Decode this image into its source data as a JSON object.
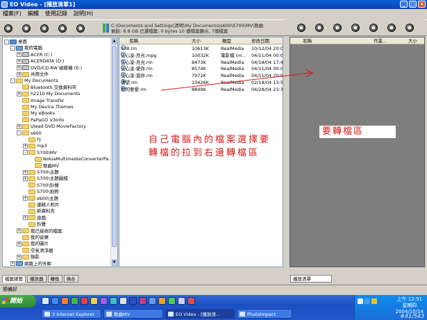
{
  "window": {
    "title": "EO Video - [播放清單1]"
  },
  "menu": [
    "檔案(F)",
    "編輯",
    "使用記錄",
    "說明(H)"
  ],
  "status_info": {
    "line1": "C:\\Documents and Settings\\清明\\My Documents\\s600\\S700\\MV\\歌曲",
    "line2": "剩餘: 8.8 GB    已選檔案: 0 bytes    10 個檔案顯示, 7個檔案"
  },
  "tree": [
    {
      "label": "桌面",
      "level": 0,
      "icon": "desk",
      "exp": "-"
    },
    {
      "label": "我的電腦",
      "level": 1,
      "icon": "pc",
      "exp": "-"
    },
    {
      "label": "ACER (C:)",
      "level": 2,
      "icon": "drive",
      "exp": "+"
    },
    {
      "label": "ACERDATA (D:)",
      "level": 2,
      "icon": "drive",
      "exp": "+"
    },
    {
      "label": "DVD/CD-RW 磁碟機 (E:)",
      "level": 2,
      "icon": "drive",
      "exp": "+"
    },
    {
      "label": "共用文件",
      "level": 2,
      "icon": "folder",
      "exp": "+"
    },
    {
      "label": "My Documents",
      "level": 1,
      "icon": "folder",
      "exp": "-"
    },
    {
      "label": "Bluetooth 交換資料夾",
      "level": 2,
      "icon": "folder",
      "exp": ""
    },
    {
      "label": "h2210 My Documents",
      "level": 2,
      "icon": "folder",
      "exp": "+"
    },
    {
      "label": "Image Transfer",
      "level": 2,
      "icon": "folder",
      "exp": ""
    },
    {
      "label": "My Device Themes",
      "level": 2,
      "icon": "folder",
      "exp": ""
    },
    {
      "label": "My eBooks",
      "level": 2,
      "icon": "folder",
      "exp": ""
    },
    {
      "label": "PaPaGO V3Info",
      "level": 2,
      "icon": "folder",
      "exp": ""
    },
    {
      "label": "Ulead DVD MovieFactory",
      "level": 2,
      "icon": "folder",
      "exp": "+"
    },
    {
      "label": "s600",
      "level": 2,
      "icon": "folder",
      "exp": "-"
    },
    {
      "label": "FJ",
      "level": 3,
      "icon": "folder",
      "exp": ""
    },
    {
      "label": "mp3",
      "level": 3,
      "icon": "folder",
      "exp": "+"
    },
    {
      "label": "S700\\MV",
      "level": 3,
      "icon": "folder",
      "exp": "-"
    },
    {
      "label": "NokiaMultimediaConverterPa",
      "level": 4,
      "icon": "folder",
      "exp": ""
    },
    {
      "label": "歌曲MV",
      "level": 4,
      "icon": "folder",
      "exp": ""
    },
    {
      "label": "S700\\主題",
      "level": 3,
      "icon": "folder",
      "exp": "+"
    },
    {
      "label": "S700\\主題圖檔",
      "level": 3,
      "icon": "folder",
      "exp": "+"
    },
    {
      "label": "S700\\鈴聲",
      "level": 3,
      "icon": "folder",
      "exp": ""
    },
    {
      "label": "S700\\拍照",
      "level": 3,
      "icon": "folder",
      "exp": ""
    },
    {
      "label": "s600\\主題",
      "level": 3,
      "icon": "folder",
      "exp": "+"
    },
    {
      "label": "連絡人照片",
      "level": 3,
      "icon": "folder",
      "exp": ""
    },
    {
      "label": "新資料夾",
      "level": 3,
      "icon": "folder",
      "exp": ""
    },
    {
      "label": "遊戲",
      "level": 3,
      "icon": "folder",
      "exp": "+"
    },
    {
      "label": "鈴聲",
      "level": 3,
      "icon": "folder",
      "exp": ""
    },
    {
      "label": "我已接收的檔案",
      "level": 2,
      "icon": "folder",
      "exp": "+"
    },
    {
      "label": "我的音樂",
      "level": 2,
      "icon": "folder",
      "exp": ""
    },
    {
      "label": "我的圖片",
      "level": 2,
      "icon": "folder",
      "exp": "+"
    },
    {
      "label": "空氣清淨器",
      "level": 2,
      "icon": "folder",
      "exp": ""
    },
    {
      "label": "錄影",
      "level": 2,
      "icon": "folder",
      "exp": "+"
    },
    {
      "label": "網路上的芳鄰",
      "level": 1,
      "icon": "pc",
      "exp": "+"
    }
  ],
  "file_columns": {
    "name": "名稱",
    "size": "大小",
    "type": "類型",
    "modified": "修改日期"
  },
  "files": [
    {
      "name": "408.rm",
      "size": "10613K",
      "type": "RealMedia",
      "modified": "10/12/04 20:04:54"
    },
    {
      "name": "王心凌-月光.mpg",
      "size": "10032K",
      "type": "電影檔 (m...",
      "modified": "04/11/04 00:05:42"
    },
    {
      "name": "王心凌-月光.rm",
      "size": "8473K",
      "type": "RealMedia",
      "modified": "04/18/04 17:47:36"
    },
    {
      "name": "王心凌-愛你.rm",
      "size": "8574K",
      "type": "RealMedia",
      "modified": "04/11/04 00:06:38"
    },
    {
      "name": "王心凌-當你.rm",
      "size": "7972K",
      "type": "RealMedia",
      "modified": "04/11/04 20:06:02"
    },
    {
      "name": "溝望.rm",
      "size": "10426K",
      "type": "RealMedia",
      "modified": "02/18/04 13:57:06"
    },
    {
      "name": "要的要愛.rm",
      "size": "8849K",
      "type": "RealMedia",
      "modified": "04/28/04 23:32:28"
    }
  ],
  "playlist_columns": {
    "name": "名稱",
    "artist": "作業...",
    "size": "大小"
  },
  "left_tabs": [
    "檔案總管",
    "播放器",
    "轉換",
    "燒合"
  ],
  "right_tab": "播放清單",
  "status_text": "預備好",
  "annotation_main": "自己電腦內的檔案選擇要轉檔的拉到右邊轉檔區",
  "annotation_target": "要轉檔區",
  "taskbar": {
    "start": "開始",
    "tasks": [
      "3 Internet Explorer",
      "歌曲MV",
      "EO Video - [播放清...",
      "PhotoImpact"
    ],
    "clock_time": "上午 12:51",
    "clock_day": "星期四",
    "clock_date": "2004/10/14",
    "watermark": "#41/543"
  },
  "colors": {
    "annotation": "#d21c1c",
    "title_bar": "#0a5fd6",
    "taskbar": "#245edb"
  }
}
